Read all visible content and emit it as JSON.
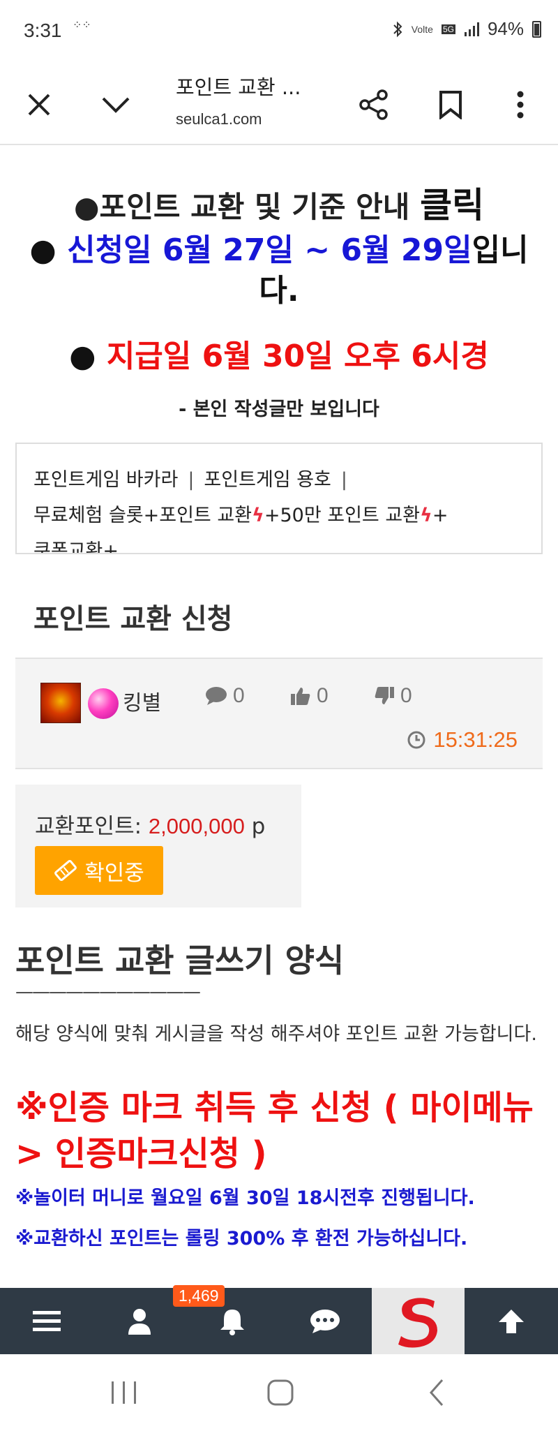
{
  "status_bar": {
    "time": "3:31",
    "notif_glyph": "⁘⁘",
    "network_label": "Volte",
    "signal_label": "5G",
    "battery": "94%"
  },
  "browser": {
    "title": "포인트 교환 ...",
    "url": "seulca1.com"
  },
  "notice": {
    "line1_prefix": "●포인트 교환 및 기준 안내 ",
    "line1_click": "클릭",
    "line2_bullet": "● ",
    "line2_blue": "신청일 6월 27일 ~ 6월 29일",
    "line2_tail": "입니다.",
    "line3_bullet": "● ",
    "line3_red": "지급일 6월 30일 오후 6시경",
    "line4": "- 본인 작성글만 보입니다"
  },
  "menu": {
    "item1": "포인트게임 바카라",
    "item2": "포인트게임 용호",
    "separator": "|",
    "item3": "무료체험 슬롯+포인트 교환",
    "item4": "+50만 포인트 교환",
    "item4_tail": "+",
    "item5": "쿠폰교환+",
    "bolt": "ϟ"
  },
  "post": {
    "title": "포인트 교환 신청",
    "author": "킹별",
    "comments": "0",
    "likes": "0",
    "dislikes": "0",
    "time": "15:31:25"
  },
  "exchange": {
    "label": "교환포인트: ",
    "value": "2,000,000",
    "unit": " p",
    "status": "확인중"
  },
  "form": {
    "title": "포인트 교환 글쓰기 양식",
    "dash": "———————————",
    "desc": "해당 양식에 맞춰 게시글을 작성 해주셔야 포인트 교환 가능합니다.",
    "warn1": "※인증 마크 취득 후 신청 ( 마이메뉴 > 인증마크신청 )",
    "warn2": "※놀이터 머니로 월요일 6월 30일 18시전후 진행됩니다.",
    "warn3": "※교환하신 포인트는 롤링 300% 후 환전 가능하십니다."
  },
  "toolbar": {
    "badge": "1,469"
  },
  "colors": {
    "blue": "#1717d6",
    "red": "#ee1111",
    "orange": "#ffa300",
    "time_orange": "#ef6a1a",
    "toolbar_bg": "#2f3a45"
  }
}
